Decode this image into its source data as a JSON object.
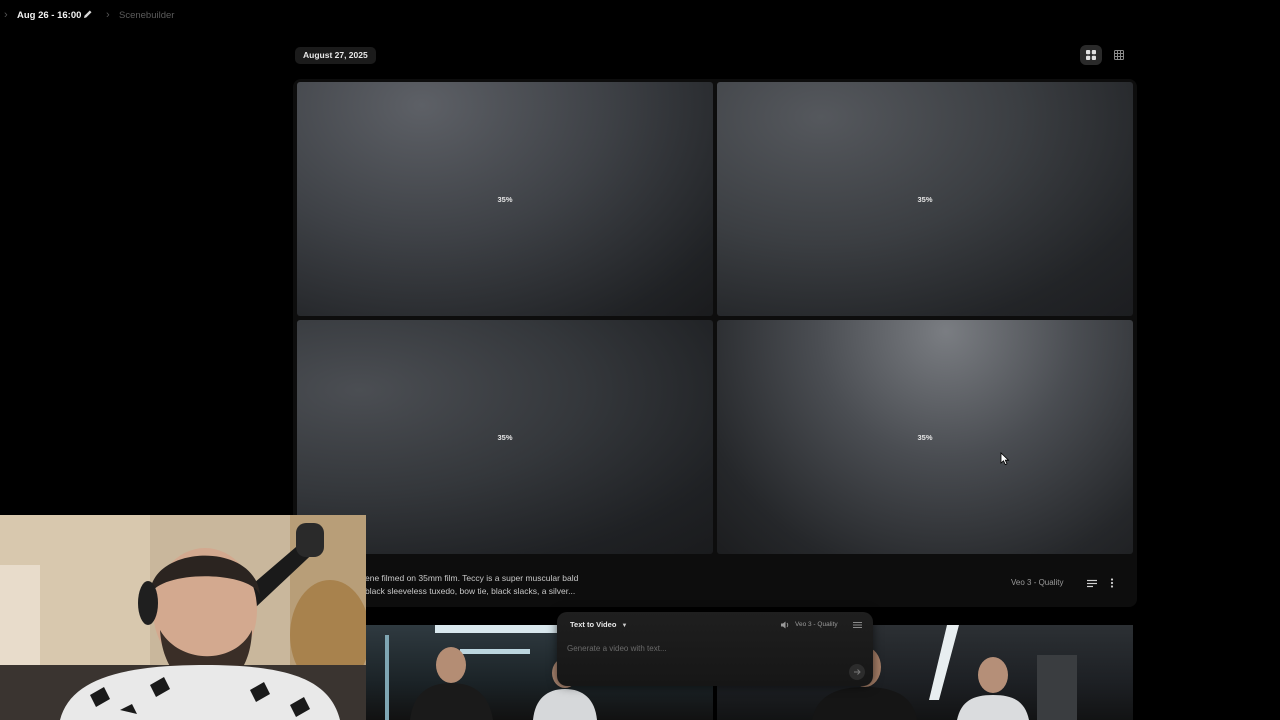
{
  "header": {
    "project_title": "Aug 26 - 16:00",
    "breadcrumb_current": "Scenebuilder"
  },
  "gallery": {
    "date": "August 27, 2025",
    "tiles": [
      {
        "progress": "35%"
      },
      {
        "progress": "35%"
      },
      {
        "progress": "35%"
      },
      {
        "progress": "35%"
      }
    ],
    "prompt_lines": [
      "ene filmed on 35mm film. Teccy is a super muscular bald",
      "black sleeveless tuxedo, bow tie, black slacks, a silver..."
    ],
    "model": "Veo 3 - Quality"
  },
  "composer": {
    "mode": "Text to Video",
    "model": "Veo 3 - Quality",
    "placeholder": "Generate a video with text..."
  },
  "icons": {
    "edit": "pencil-icon",
    "grid_view": "grid-view-icon",
    "list_view": "list-view-icon",
    "more": "more-vertical-icon",
    "settings": "sliders-icon",
    "audio": "speaker-icon",
    "send": "arrow-right-icon"
  },
  "colors": {
    "background": "#000000",
    "panel": "#0d0d0d",
    "chip": "#1b1b1b"
  }
}
